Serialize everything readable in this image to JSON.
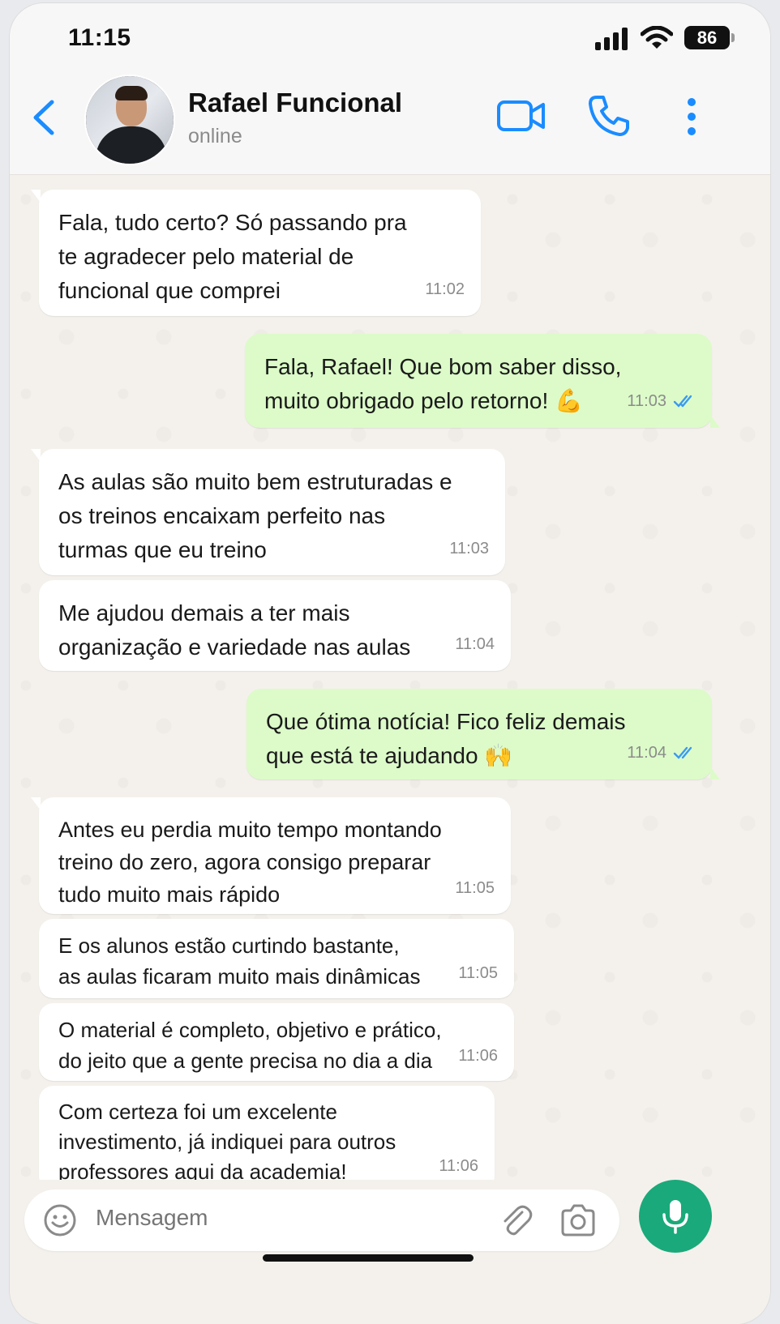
{
  "status_bar": {
    "time": "11:15",
    "battery": "86"
  },
  "header": {
    "contact_name": "Rafael Funcional",
    "contact_status": "online",
    "icons": [
      "back-chevron-icon",
      "video-call-icon",
      "phone-call-icon",
      "more-vertical-icon"
    ],
    "accent_color": "#1a8cff"
  },
  "messages": [
    {
      "dir": "in",
      "text": "Fala, tudo certo? Só passando pra\nte agradecer pelo material de\nfuncional que comprei",
      "time": "11:02"
    },
    {
      "dir": "out",
      "text": "Fala, Rafael! Que bom saber disso,\nmuito obrigado pelo retorno! 💪",
      "time": "11:03",
      "read": true
    },
    {
      "dir": "in",
      "text": "As aulas são muito bem estruturadas e\nos treinos encaixam perfeito nas\nturmas que eu treino",
      "time": "11:03"
    },
    {
      "dir": "in",
      "text": "Me ajudou demais a ter mais\norganização e variedade nas aulas",
      "time": "11:04"
    },
    {
      "dir": "out",
      "text": "Que ótima notícia! Fico feliz demais\nque está te ajudando 🙌",
      "time": "11:04",
      "read": true
    },
    {
      "dir": "in",
      "text": "Antes eu perdia muito tempo montando\ntreino do zero, agora consigo preparar\ntudo muito mais rápido",
      "time": "11:05"
    },
    {
      "dir": "in",
      "text": "E os alunos estão curtindo bastante,\nas aulas ficaram muito mais dinâmicas",
      "time": "11:05"
    },
    {
      "dir": "in",
      "text": "O material é completo, objetivo e prático,\ndo jeito que a gente precisa no dia a dia",
      "time": "11:06"
    },
    {
      "dir": "in",
      "text": "Com certeza foi um excelente\ninvestimento, já indiquei para outros\nprofessores aqui da academia!",
      "time": "11:06"
    }
  ],
  "composer": {
    "placeholder": "Mensagem",
    "icons": [
      "emoji-icon",
      "paperclip-icon",
      "camera-icon",
      "microphone-icon"
    ],
    "mic_color": "#1aa97a"
  },
  "colors": {
    "incoming_bubble": "#ffffff",
    "outgoing_bubble": "#dcfbc9",
    "read_tick": "#3b9af0"
  }
}
